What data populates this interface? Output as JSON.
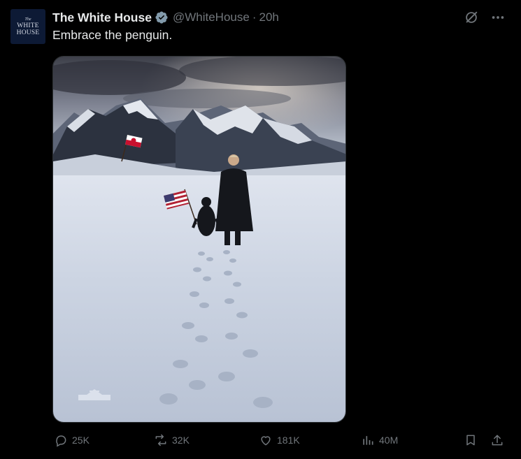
{
  "post": {
    "avatar_text_small": "The",
    "avatar_text_line1": "WHITE",
    "avatar_text_line2": "HOUSE",
    "display_name": "The White House",
    "handle": "@WhiteHouse",
    "separator": "·",
    "time": "20h",
    "text": "Embrace the penguin."
  },
  "icons": {
    "verified": "verified-badge-icon",
    "grok": "grok-icon",
    "more": "more-icon",
    "reply": "reply-icon",
    "repost": "repost-icon",
    "like": "like-icon",
    "views": "views-icon",
    "bookmark": "bookmark-icon",
    "share": "share-icon"
  },
  "metrics": {
    "replies": "25K",
    "reposts": "32K",
    "likes": "181K",
    "views": "40M"
  },
  "colors": {
    "background": "#000000",
    "text_primary": "#e7e9ea",
    "text_secondary": "#71767b",
    "verified": "#829aab"
  }
}
